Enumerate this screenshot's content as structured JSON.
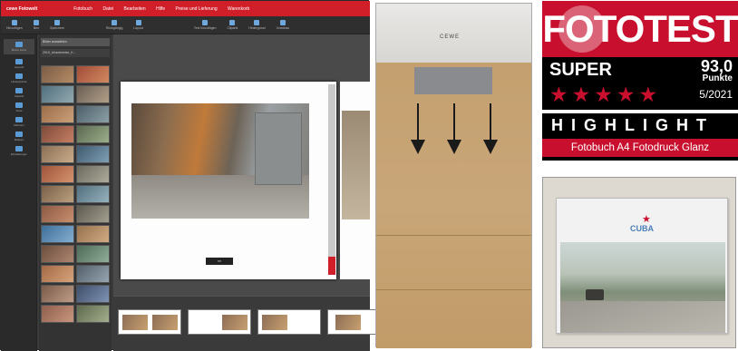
{
  "editor": {
    "title": "cewe Fotowelt",
    "menu": [
      "Fotobuch",
      "Datei",
      "Bearbeiten",
      "Hilfe",
      "Preise und Lieferung",
      "Warenkorb"
    ],
    "toolbar": [
      "Hinzufügen",
      "Neu",
      "Speichern",
      "Rückgängig",
      "Layout",
      "Text hinzufügen",
      "Cliparts",
      "Hintergrund",
      "Vorschau"
    ],
    "sidebar": [
      "Meine Fotos",
      "Layouts",
      "Hintergründe",
      "Cliparts",
      "Texte",
      "Rahmen",
      "Masken",
      "Einstellungen"
    ],
    "folder_label": "Bilder auswählen",
    "album_label": "2019_Urlaubsreise_K..."
  },
  "box": {
    "brand": "CEWE"
  },
  "badge": {
    "heading": "FOTOTEST",
    "rating": "SUPER",
    "score": "93,0",
    "score_unit": "Punkte",
    "stars": [
      "★",
      "★",
      "★",
      "★",
      "★"
    ],
    "date": "5/2021",
    "highlight": "HIGHLIGHT",
    "product": "Fotobuch A4 Fotodruck Glanz",
    "colors": {
      "red": "#c8102e",
      "black": "#000000"
    }
  },
  "book": {
    "star": "★",
    "title": "CUBA"
  }
}
